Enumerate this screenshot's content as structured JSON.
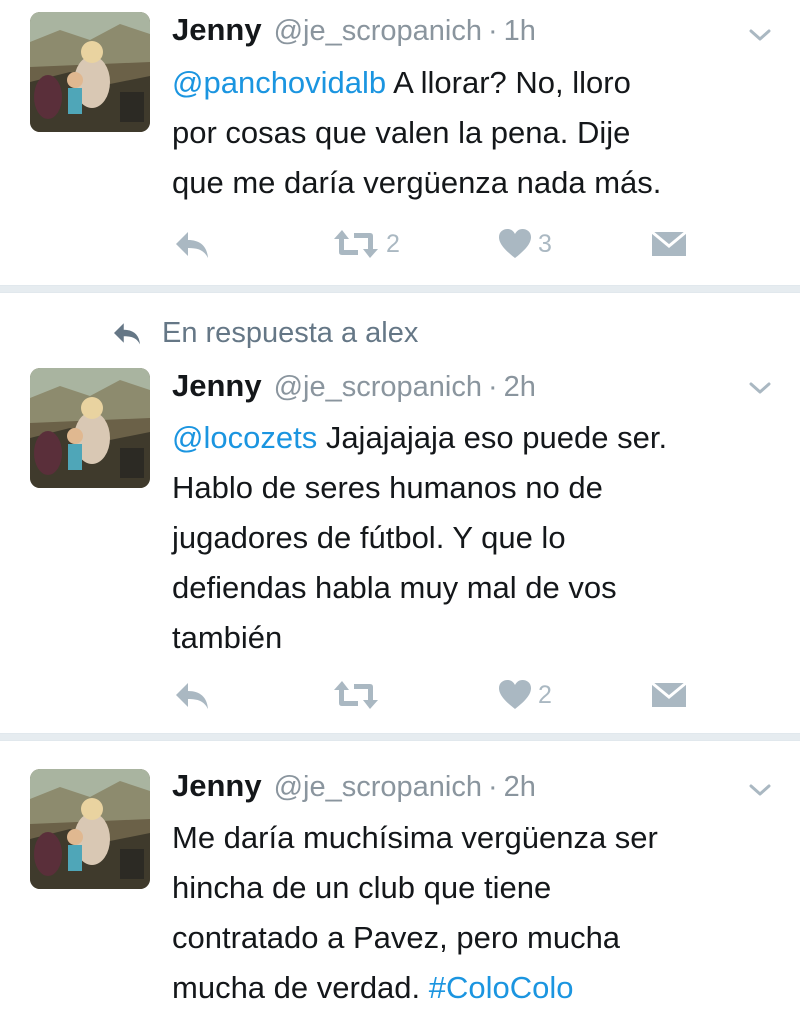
{
  "tweets": [
    {
      "name": "Jenny",
      "handle": "@je_scropanich",
      "separator": "·",
      "time": "1h",
      "mention": "@panchovidalb",
      "text_line1_rest": " A llorar? No, lloro",
      "text_line2": "por cosas que valen la pena. Dije",
      "text_line3": "que me daría vergüenza nada más.",
      "retweets": "2",
      "likes": "3"
    },
    {
      "context": "En respuesta a alex",
      "name": "Jenny",
      "handle": "@je_scropanich",
      "separator": "·",
      "time": "2h",
      "mention": "@locozets",
      "text_line1_rest": " Jajajajaja eso puede ser.",
      "text_line2": "Hablo de seres humanos no de",
      "text_line3": "jugadores de fútbol. Y que lo",
      "text_line4": "defiendas habla muy mal de vos",
      "text_line5": "también",
      "likes": "2"
    },
    {
      "name": "Jenny",
      "handle": "@je_scropanich",
      "separator": "·",
      "time": "2h",
      "text_line1": "Me daría muchísima vergüenza ser",
      "text_line2": "hincha de un club que tiene",
      "text_line3": "contratado a Pavez, pero mucha",
      "text_line4_start": "mucha de verdad. ",
      "hashtag": "#ColoColo"
    }
  ],
  "colors": {
    "link": "#1b95e0",
    "muted": "#8a959e",
    "icon": "#aab8c2",
    "separator": "#e6ecf0"
  },
  "icons": [
    "reply-icon",
    "retweet-icon",
    "like-icon",
    "dm-icon",
    "chevron-down-icon",
    "reply-context-icon"
  ]
}
